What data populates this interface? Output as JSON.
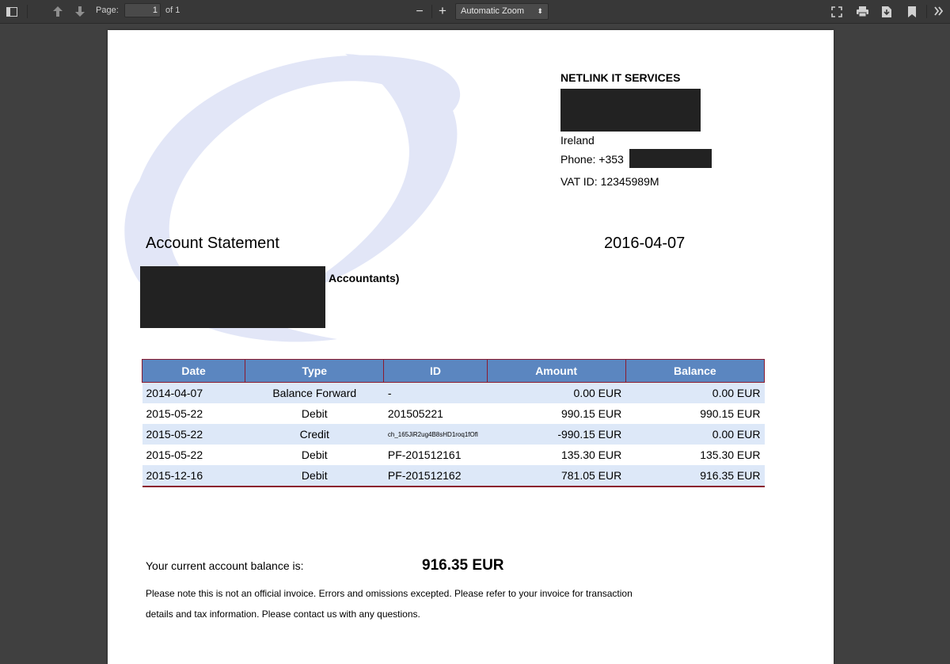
{
  "toolbar": {
    "page_label": "Page:",
    "page_value": "1",
    "page_of": "of 1",
    "zoom_label": "Automatic Zoom",
    "zoom_arrow": "⬍",
    "zoom_out": "−",
    "zoom_in": "+"
  },
  "company": {
    "name": "NETLINK IT SERVICES",
    "country": "Ireland",
    "phone": "Phone: +353",
    "vat": "VAT ID: 12345989M"
  },
  "statement": {
    "title": "Account Statement",
    "date": "2016-04-07",
    "customer_suffix": "Accountants)"
  },
  "table": {
    "headers": [
      "Date",
      "Type",
      "ID",
      "Amount",
      "Balance"
    ],
    "rows": [
      {
        "date": "2014-04-07",
        "type": "Balance Forward",
        "id": "-",
        "amount": "0.00 EUR",
        "balance": "0.00 EUR"
      },
      {
        "date": "2015-05-22",
        "type": "Debit",
        "id": "201505221",
        "amount": "990.15 EUR",
        "balance": "990.15 EUR"
      },
      {
        "date": "2015-05-22",
        "type": "Credit",
        "id": "ch_165JiR2ug4B8sHD1roq1fOfl",
        "amount": "-990.15 EUR",
        "balance": "0.00 EUR"
      },
      {
        "date": "2015-05-22",
        "type": "Debit",
        "id": "PF-201512161",
        "amount": "135.30 EUR",
        "balance": "135.30 EUR"
      },
      {
        "date": "2015-12-16",
        "type": "Debit",
        "id": "PF-201512162",
        "amount": "781.05 EUR",
        "balance": "916.35 EUR"
      }
    ]
  },
  "summary": {
    "label": "Your current account balance is:",
    "value": "916.35 EUR",
    "note_line1": "Please note this is not an official invoice. Errors and omissions excepted. Please refer to your invoice for transaction",
    "note_line2": "details and tax information. Please contact us with any questions."
  },
  "colors": {
    "header_bg": "#5b86c0",
    "border": "#8b1a2e",
    "alt_row": "#dde8f8",
    "redaction": "#222222"
  },
  "icons": [
    "sidebar-toggle-icon",
    "previous-page-icon",
    "next-page-icon",
    "presentation-mode-icon",
    "print-icon",
    "download-icon",
    "bookmark-icon",
    "tools-icon"
  ]
}
